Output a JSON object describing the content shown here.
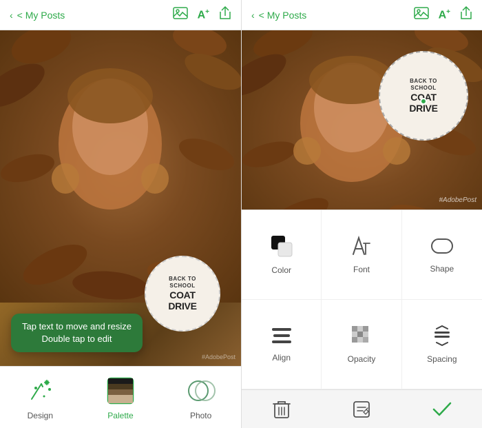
{
  "leftPanel": {
    "topBar": {
      "backLabel": "< My Posts",
      "shareIcon": "share-icon"
    },
    "badge": {
      "line1": "BACK TO",
      "line2": "SCHOOL",
      "coat": "COAT",
      "drive": "DRIVE"
    },
    "tooltip": {
      "line1": "Tap text to move and resize",
      "line2": "Double tap to edit"
    },
    "watermark": "#AdobePost",
    "toolbar": {
      "items": [
        {
          "id": "design",
          "label": "Design",
          "icon": "sparkle"
        },
        {
          "id": "palette",
          "label": "Palette",
          "icon": "palette"
        },
        {
          "id": "photo",
          "label": "Photo",
          "icon": "photo"
        }
      ]
    }
  },
  "rightPanel": {
    "topBar": {
      "backLabel": "< My Posts",
      "shareIcon": "share-icon"
    },
    "badge": {
      "line1": "BACK TO",
      "line2": "SCHOOL",
      "coat": "COAT",
      "drive": "DRIVE"
    },
    "watermark": "#AdobePost",
    "tools": [
      {
        "id": "color",
        "label": "Color",
        "icon": "color-icon"
      },
      {
        "id": "font",
        "label": "Font",
        "icon": "font-icon"
      },
      {
        "id": "shape",
        "label": "Shape",
        "icon": "shape-icon"
      },
      {
        "id": "align",
        "label": "Align",
        "icon": "align-icon"
      },
      {
        "id": "opacity",
        "label": "Opacity",
        "icon": "opacity-icon"
      },
      {
        "id": "spacing",
        "label": "Spacing",
        "icon": "spacing-icon"
      }
    ],
    "actions": [
      {
        "id": "delete",
        "label": "Delete",
        "icon": "trash-icon"
      },
      {
        "id": "edit",
        "label": "Edit",
        "icon": "edit-icon"
      },
      {
        "id": "confirm",
        "label": "Confirm",
        "icon": "check-icon"
      }
    ]
  }
}
